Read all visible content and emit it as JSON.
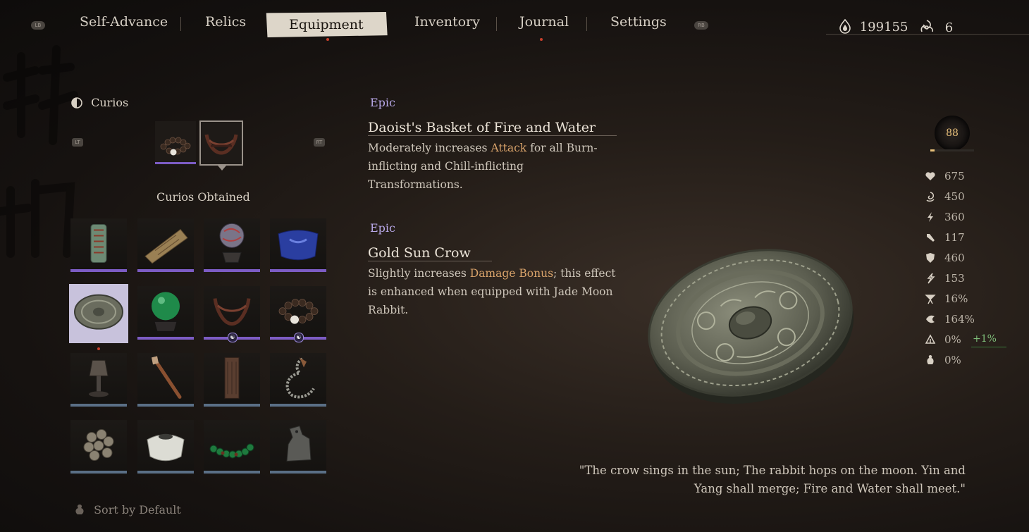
{
  "nav": {
    "left_button": "LB",
    "right_button": "RB",
    "tabs": [
      {
        "label": "Self-Advance"
      },
      {
        "label": "Relics"
      },
      {
        "label": "Equipment"
      },
      {
        "label": "Inventory"
      },
      {
        "label": "Journal"
      },
      {
        "label": "Settings"
      }
    ],
    "active_tab": "Equipment"
  },
  "currency": {
    "will": "199155",
    "spirit": "6"
  },
  "curios": {
    "section_label": "Curios",
    "lt_button": "LT",
    "rt_button": "RT",
    "obtained_label": "Curios Obtained",
    "sort_label": "Sort by Default",
    "grid": [
      {
        "name": "jade-tablet",
        "rarity": "epic"
      },
      {
        "name": "bamboo-scroll",
        "rarity": "epic"
      },
      {
        "name": "painted-orb",
        "rarity": "epic"
      },
      {
        "name": "blue-jar",
        "rarity": "epic"
      },
      {
        "name": "bronze-mirror",
        "rarity": "epic",
        "selected": true
      },
      {
        "name": "green-pearl",
        "rarity": "epic"
      },
      {
        "name": "woven-basket",
        "rarity": "epic",
        "equipped": true
      },
      {
        "name": "prayer-beads",
        "rarity": "epic",
        "equipped": true
      },
      {
        "name": "incense-burner",
        "rarity": "rare"
      },
      {
        "name": "wooden-brush",
        "rarity": "rare"
      },
      {
        "name": "wood-carving",
        "rarity": "rare"
      },
      {
        "name": "bone-chain",
        "rarity": "rare"
      },
      {
        "name": "silver-bells",
        "rarity": "rare"
      },
      {
        "name": "white-jar",
        "rarity": "rare"
      },
      {
        "name": "green-beads",
        "rarity": "rare"
      },
      {
        "name": "stone-beast",
        "rarity": "rare"
      }
    ]
  },
  "items": [
    {
      "rarity": "Epic",
      "name": "Daoist's Basket of Fire and Water",
      "desc_before": "Moderately increases ",
      "desc_highlight": "Attack",
      "desc_after": " for all Burn-inflicting and Chill-inflicting Transformations."
    },
    {
      "rarity": "Epic",
      "name": "Gold Sun Crow",
      "desc_before": "Slightly increases ",
      "desc_highlight": "Damage Bonus",
      "desc_after": "; this effect is enhanced when equipped with Jade Moon Rabbit."
    }
  ],
  "stats": {
    "level": "88",
    "level_progress": 0.1,
    "rows": [
      {
        "icon": "heart-icon",
        "value": "675"
      },
      {
        "icon": "mana-swirl-icon",
        "value": "450"
      },
      {
        "icon": "stamina-bolt-icon",
        "value": "360"
      },
      {
        "icon": "attack-icon",
        "value": "117"
      },
      {
        "icon": "defense-shield-icon",
        "value": "460"
      },
      {
        "icon": "spirit-bolt-icon",
        "value": "153"
      },
      {
        "icon": "crit-chance-icon",
        "value": "16%"
      },
      {
        "icon": "crit-damage-icon",
        "value": "164%"
      },
      {
        "icon": "resistance-icon",
        "value": "0%",
        "bonus": "+1%"
      },
      {
        "icon": "gourd-icon",
        "value": "0%"
      }
    ]
  },
  "quote": "\"The crow sings in the sun; The rabbit hops on the moon. Yin and Yang shall merge; Fire and Water shall meet.\"",
  "colors": {
    "epic": "#7c5cc4",
    "rare": "#5a6f86",
    "highlight": "#d9a36a",
    "bonus": "#7fbf7a"
  }
}
